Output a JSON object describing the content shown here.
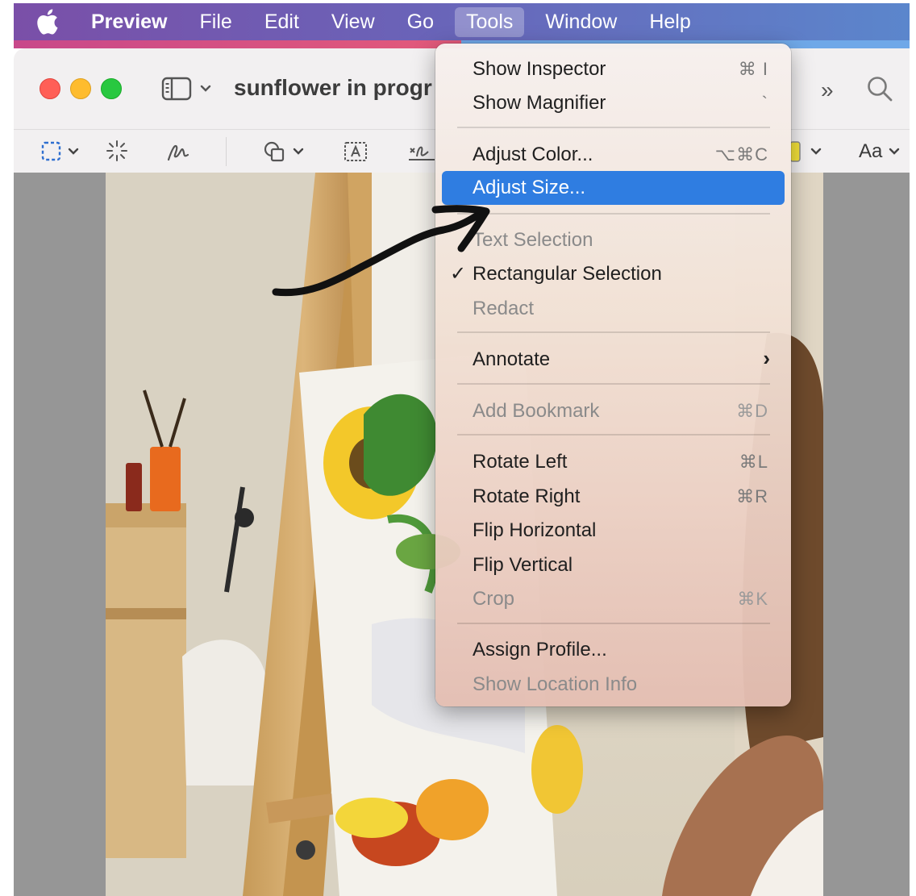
{
  "menubar": {
    "app_name": "Preview",
    "items": [
      "File",
      "Edit",
      "View",
      "Go",
      "Tools",
      "Window",
      "Help"
    ]
  },
  "window": {
    "title": "sunflower in progr",
    "traffic_lights": [
      "close",
      "minimize",
      "zoom"
    ]
  },
  "toolbar": {
    "font_label": "Aa",
    "more_label": "»"
  },
  "tools_menu": {
    "items": [
      {
        "label": "Show Inspector",
        "shortcut": "⌘ I"
      },
      {
        "label": "Show Magnifier",
        "shortcut": "`"
      },
      {
        "label": "Adjust Color...",
        "shortcut": "⌥⌘C"
      },
      {
        "label": "Adjust Size...",
        "shortcut": "",
        "highlighted": true
      },
      {
        "label": "Text Selection",
        "disabled": true
      },
      {
        "label": "Rectangular Selection",
        "checked": true
      },
      {
        "label": "Redact",
        "disabled": true
      },
      {
        "label": "Annotate",
        "submenu": true
      },
      {
        "label": "Add Bookmark",
        "shortcut": "⌘D",
        "disabled": true
      },
      {
        "label": "Rotate Left",
        "shortcut": "⌘L"
      },
      {
        "label": "Rotate Right",
        "shortcut": "⌘R"
      },
      {
        "label": "Flip Horizontal"
      },
      {
        "label": "Flip Vertical"
      },
      {
        "label": "Crop",
        "shortcut": "⌘K",
        "disabled": true
      },
      {
        "label": "Assign Profile..."
      },
      {
        "label": "Show Location Info",
        "disabled": true
      }
    ],
    "check_mark": "✓",
    "submenu_arrow": "›"
  },
  "colors": {
    "highlight": "#2f7de1",
    "menubar_left": "#7a4fa8",
    "menubar_right": "#5b86cc"
  }
}
